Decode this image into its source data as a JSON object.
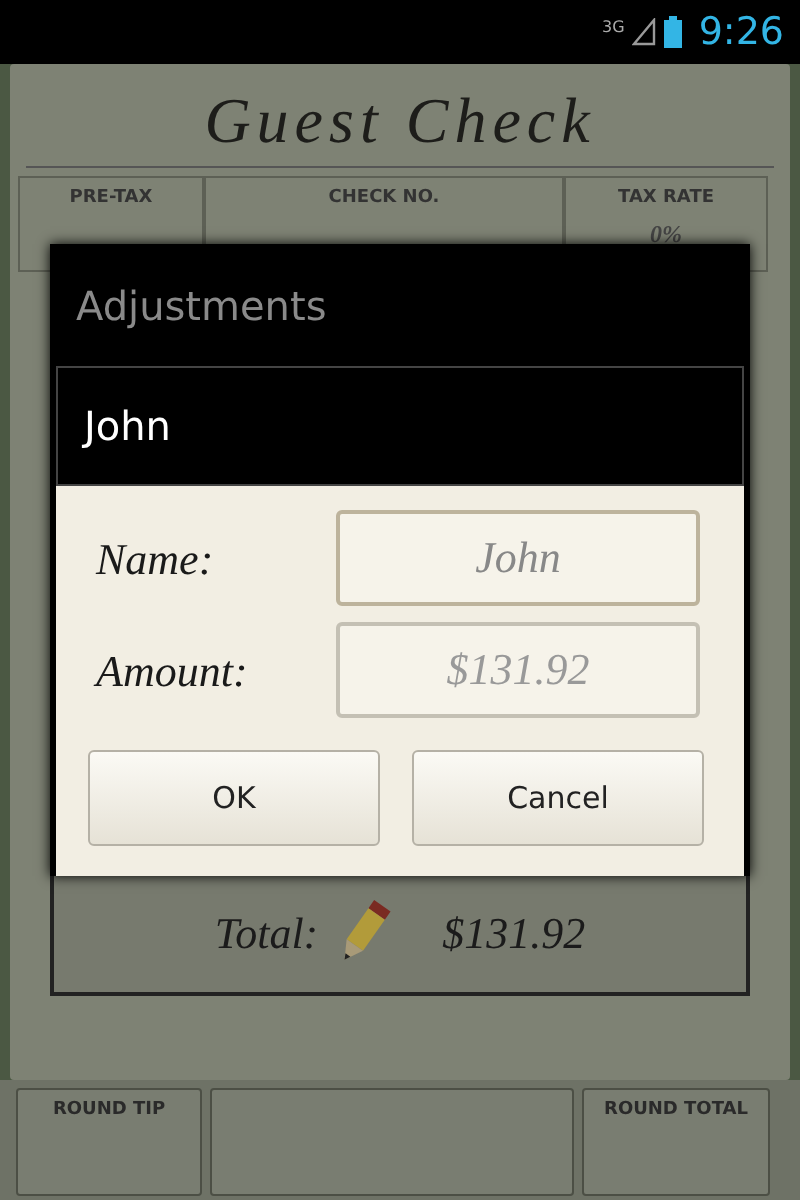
{
  "status_bar": {
    "network": "3G",
    "time": "9:26"
  },
  "check": {
    "title": "Guest Check",
    "header_fields": [
      {
        "label": "PRE-TAX"
      },
      {
        "label": "CHECK NO."
      },
      {
        "label": "TAX RATE",
        "value": "0%"
      }
    ],
    "total_label": "Total:",
    "total_value": "$131.92"
  },
  "bottom_buttons": [
    {
      "kind": "labeled",
      "label": "ROUND TIP"
    },
    {
      "kind": "blank"
    },
    {
      "kind": "labeled",
      "label": "ROUND TOTAL"
    }
  ],
  "dialog": {
    "title": "Adjustments",
    "subtitle": "John",
    "fields": [
      {
        "label": "Name:",
        "value": "John",
        "focused": true
      },
      {
        "label": "Amount:",
        "placeholder": "$131.92",
        "focused": false
      }
    ],
    "buttons": [
      "OK",
      "Cancel"
    ]
  }
}
